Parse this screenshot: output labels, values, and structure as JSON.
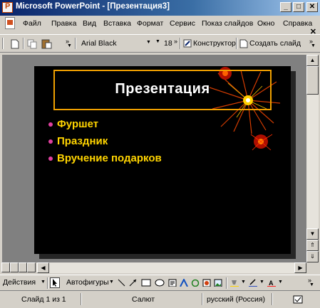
{
  "window": {
    "title": "Microsoft PowerPoint - [Презентация3]",
    "minimize": "_",
    "maximize": "□",
    "close": "✕"
  },
  "menu": [
    "Файл",
    "Правка",
    "Вид",
    "Вставка",
    "Формат",
    "Сервис",
    "Показ слайдов",
    "Окно",
    "Справка"
  ],
  "doc_close": "✕",
  "toolbar": {
    "font_name": "Arial Black",
    "font_size": "18",
    "designer_label": "Конструктор",
    "new_slide_label": "Создать слайд"
  },
  "slide": {
    "title": "Презентация",
    "bullets": [
      "Фуршет",
      "Праздник",
      "Вручение подарков"
    ]
  },
  "drawing": {
    "actions_label": "Действия",
    "autoshapes_label": "Автофигуры"
  },
  "status": {
    "slide": "Слайд 1 из 1",
    "design": "Салют",
    "language": "русский (Россия)"
  },
  "colors": {
    "titlebar": "#0a246a",
    "slide_bg": "#000000",
    "title_frame": "#f0a000",
    "bullet_text": "#ffd400",
    "bullet_dot": "#e040a0"
  }
}
